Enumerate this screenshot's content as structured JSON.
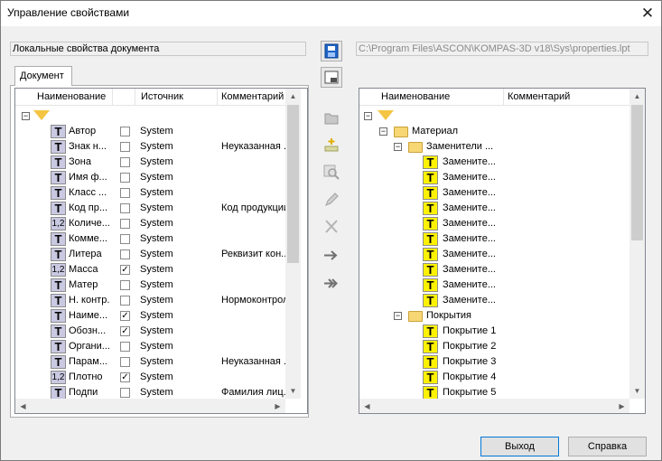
{
  "window": {
    "title": "Управление свойствами",
    "close": "✕"
  },
  "left_label": "Локальные свойства документа",
  "right_path": "C:\\Program Files\\ASCON\\KOMPAS-3D v18\\Sys\\properties.lpt",
  "tab": "Документ",
  "left_cols": [
    "Наименование",
    "Источник",
    "Комментарий"
  ],
  "left_rows": [
    {
      "name": "Автор",
      "icon": "T",
      "chk": false,
      "src": "System",
      "cmt": ""
    },
    {
      "name": "Знак н...",
      "icon": "T",
      "chk": false,
      "src": "System",
      "cmt": "Неуказанная ..."
    },
    {
      "name": "Зона",
      "icon": "T",
      "chk": false,
      "src": "System",
      "cmt": ""
    },
    {
      "name": "Имя ф...",
      "icon": "T",
      "chk": false,
      "src": "System",
      "cmt": ""
    },
    {
      "name": "Класс ...",
      "icon": "T",
      "chk": false,
      "src": "System",
      "cmt": ""
    },
    {
      "name": "Код пр...",
      "icon": "T",
      "chk": false,
      "src": "System",
      "cmt": "Код продукции"
    },
    {
      "name": "Количе...",
      "icon": "1,2",
      "chk": false,
      "src": "System",
      "cmt": ""
    },
    {
      "name": "Комме...",
      "icon": "T",
      "chk": false,
      "src": "System",
      "cmt": ""
    },
    {
      "name": "Литера",
      "icon": "T",
      "chk": false,
      "src": "System",
      "cmt": "Реквизит кон..."
    },
    {
      "name": "Масса",
      "icon": "1,2",
      "chk": true,
      "src": "System",
      "cmt": ""
    },
    {
      "name": "Матер",
      "icon": "T",
      "chk": false,
      "src": "System",
      "cmt": ""
    },
    {
      "name": "Н. контр.",
      "icon": "T",
      "chk": false,
      "src": "System",
      "cmt": "Нормоконтрол..."
    },
    {
      "name": "Наиме...",
      "icon": "T",
      "chk": true,
      "src": "System",
      "cmt": ""
    },
    {
      "name": "Обозн...",
      "icon": "T",
      "chk": true,
      "src": "System",
      "cmt": ""
    },
    {
      "name": "Органи...",
      "icon": "T",
      "chk": false,
      "src": "System",
      "cmt": ""
    },
    {
      "name": "Парам...",
      "icon": "T",
      "chk": false,
      "src": "System",
      "cmt": "Неуказанная ..."
    },
    {
      "name": "Плотно",
      "icon": "1,2",
      "chk": true,
      "src": "System",
      "cmt": ""
    },
    {
      "name": "Подпи",
      "icon": "T",
      "chk": false,
      "src": "System",
      "cmt": "Фамилия лиц..."
    }
  ],
  "right_cols": [
    "Наименование",
    "Комментарий"
  ],
  "right_rows": [
    {
      "name": "Материал",
      "type": "folder",
      "level": 1
    },
    {
      "name": "Заменители ...",
      "type": "folder",
      "level": 2
    },
    {
      "name": "Заменитe...",
      "type": "item",
      "level": 3
    },
    {
      "name": "Заменитe...",
      "type": "item",
      "level": 3
    },
    {
      "name": "Заменитe...",
      "type": "item",
      "level": 3
    },
    {
      "name": "Заменитe...",
      "type": "item",
      "level": 3
    },
    {
      "name": "Заменитe...",
      "type": "item",
      "level": 3
    },
    {
      "name": "Заменитe...",
      "type": "item",
      "level": 3
    },
    {
      "name": "Заменитe...",
      "type": "item",
      "level": 3
    },
    {
      "name": "Заменитe...",
      "type": "item",
      "level": 3
    },
    {
      "name": "Заменитe...",
      "type": "item",
      "level": 3
    },
    {
      "name": "Заменитe...",
      "type": "item",
      "level": 3
    },
    {
      "name": "Покрытия",
      "type": "folder",
      "level": 2
    },
    {
      "name": "Покрытие 1",
      "type": "item",
      "level": 3
    },
    {
      "name": "Покрытие 2",
      "type": "item",
      "level": 3
    },
    {
      "name": "Покрытие 3",
      "type": "item",
      "level": 3
    },
    {
      "name": "Покрытие 4",
      "type": "item",
      "level": 3
    },
    {
      "name": "Покрытие 5",
      "type": "item",
      "level": 3
    }
  ],
  "buttons": {
    "exit": "Выход",
    "help": "Справка"
  }
}
